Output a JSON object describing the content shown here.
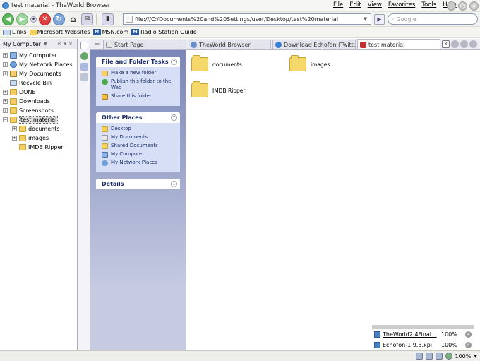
{
  "window": {
    "title": "test material - TheWorld Browser"
  },
  "menu": [
    "File",
    "Edit",
    "View",
    "Favorites",
    "Tools",
    "Help"
  ],
  "address": {
    "value": "file:///C:/Documents%20and%20Settings/user/Desktop/test%20material"
  },
  "search": {
    "placeholder": "Google"
  },
  "links": [
    "Links",
    "Microsoft Websites",
    "MSN.com",
    "Radio Station Guide"
  ],
  "sidebar": {
    "header": "My Computer",
    "tree": [
      {
        "label": "My Computer",
        "pm": "+",
        "indent": 0,
        "icon": "comp"
      },
      {
        "label": "My Network Places",
        "pm": "+",
        "indent": 0,
        "icon": "net"
      },
      {
        "label": "My Documents",
        "pm": "+",
        "indent": 0,
        "icon": "docs"
      },
      {
        "label": "Recycle Bin",
        "pm": "",
        "indent": 0,
        "icon": "bin"
      },
      {
        "label": "DONE",
        "pm": "+",
        "indent": 0,
        "icon": "folder"
      },
      {
        "label": "Downloads",
        "pm": "+",
        "indent": 0,
        "icon": "folder"
      },
      {
        "label": "Screenshots",
        "pm": "+",
        "indent": 0,
        "icon": "folder"
      },
      {
        "label": "test material",
        "pm": "-",
        "indent": 0,
        "icon": "folder",
        "selected": true
      },
      {
        "label": "documents",
        "pm": "+",
        "indent": 1,
        "icon": "folder"
      },
      {
        "label": "images",
        "pm": "+",
        "indent": 1,
        "icon": "folder"
      },
      {
        "label": "IMDB Ripper",
        "pm": "",
        "indent": 1,
        "icon": "folder"
      }
    ]
  },
  "tabs": [
    {
      "label": "Start Page",
      "active": false
    },
    {
      "label": "TheWorld Browser",
      "active": false
    },
    {
      "label": "Download Echofon (Twitt...",
      "active": false
    },
    {
      "label": "test material",
      "active": true
    }
  ],
  "tasks": {
    "file_folder": {
      "title": "File and Folder Tasks",
      "items": [
        "Make a new folder",
        "Publish this folder to the Web",
        "Share this folder"
      ]
    },
    "other_places": {
      "title": "Other Places",
      "items": [
        "Desktop",
        "My Documents",
        "Shared Documents",
        "My Computer",
        "My Network Places"
      ]
    },
    "details": {
      "title": "Details"
    }
  },
  "files": [
    "documents",
    "images",
    "IMDB Ripper"
  ],
  "downloads": [
    {
      "name": "TheWorld2.4Final...",
      "percent": "100%"
    },
    {
      "name": "Echofon-1.9.3.xpi",
      "percent": "100%"
    }
  ],
  "status": {
    "zoom": "100%"
  }
}
